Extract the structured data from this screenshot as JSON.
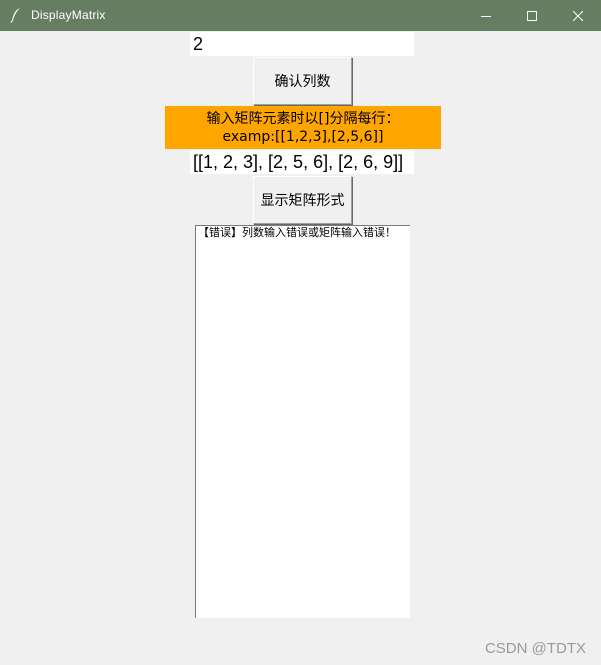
{
  "window": {
    "title": "DisplayMatrix",
    "icon": "feather-icon",
    "controls": [
      "minimize-icon",
      "maximize-icon",
      "close-icon"
    ],
    "titlebar_color": "#667d61"
  },
  "column_entry": {
    "value": "2"
  },
  "confirm_button": {
    "label": "确认列数"
  },
  "hint": {
    "line1": "输入矩阵元素时以[]分隔每行：",
    "line2": "examp:[[1,2,3],[2,5,6]]",
    "background": "#ffa500"
  },
  "matrix_entry": {
    "value": "[[1, 2, 3], [2, 5, 6], [2, 6, 9]]"
  },
  "show_button": {
    "label": "显示矩阵形式"
  },
  "output": {
    "text": "【错误】列数输入错误或矩阵输入错误！"
  },
  "watermark": {
    "text": "CSDN @TDTX"
  }
}
